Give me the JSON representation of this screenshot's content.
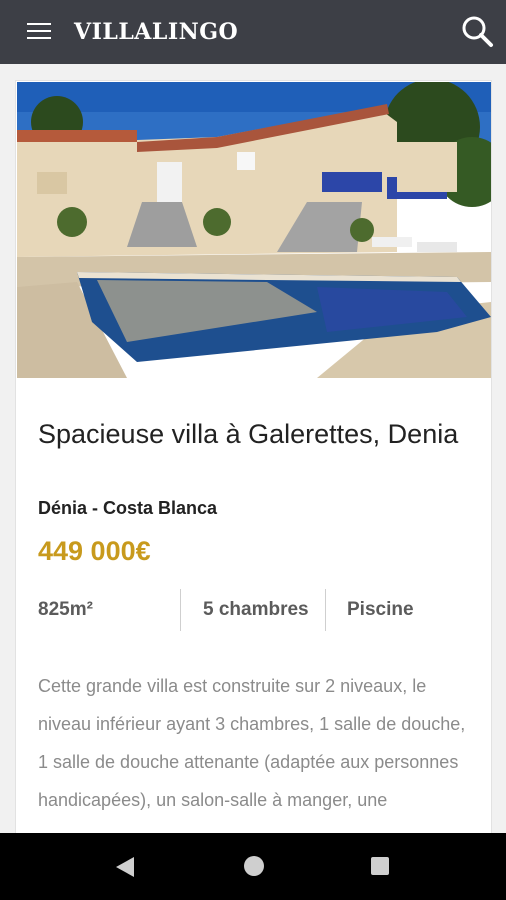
{
  "header": {
    "brand": "VILLALINGO",
    "menu_icon": "hamburger-menu-icon",
    "search_icon": "search-icon"
  },
  "listing": {
    "photo": "villa-pool-photo",
    "title": "Spacieuse villa à Galerettes, Denia",
    "location": "Dénia - Costa Blanca",
    "price": "449 000€",
    "specs": [
      {
        "label": "825m²"
      },
      {
        "label": "5 chambres"
      },
      {
        "label": "Piscine"
      }
    ],
    "description": "Cette grande villa est construite sur 2 niveaux, le niveau inférieur ayant 3 chambres, 1 salle de douche, 1 salle de douche attenante (adaptée aux personnes handicapées), un salon-salle à manger, une"
  },
  "colors": {
    "topbar": "#3d3f46",
    "price": "#c89a1d",
    "navbar": "#000000"
  },
  "system_nav": {
    "back_icon": "back-triangle-icon",
    "home_icon": "home-circle-icon",
    "recents_icon": "recents-square-icon"
  }
}
